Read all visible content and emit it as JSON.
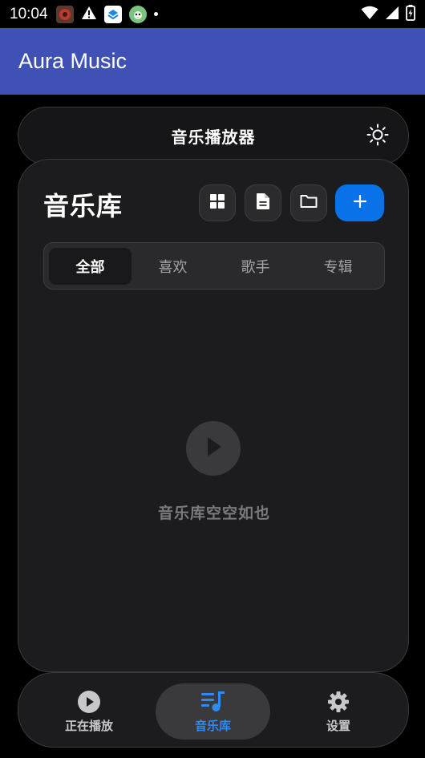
{
  "status_bar": {
    "time": "10:04"
  },
  "app_bar": {
    "title": "Aura Music"
  },
  "header": {
    "title": "音乐播放器",
    "theme_icon": "sun-icon"
  },
  "library": {
    "title": "音乐库",
    "tools": [
      {
        "icon": "grid-icon"
      },
      {
        "icon": "document-icon"
      },
      {
        "icon": "folder-icon"
      }
    ],
    "add_icon": "plus-icon",
    "tabs": [
      {
        "label": "全部",
        "active": true
      },
      {
        "label": "喜欢",
        "active": false
      },
      {
        "label": "歌手",
        "active": false
      },
      {
        "label": "专辑",
        "active": false
      }
    ],
    "empty_state": {
      "icon": "play-icon",
      "text": "音乐库空空如也"
    }
  },
  "bottom_nav": {
    "items": [
      {
        "label": "正在播放",
        "icon": "play-circle-icon",
        "active": false
      },
      {
        "label": "音乐库",
        "icon": "music-queue-icon",
        "active": true
      },
      {
        "label": "设置",
        "icon": "gear-icon",
        "active": false
      }
    ]
  },
  "colors": {
    "app_bar": "#3f51b5",
    "accent": "#0a72e8",
    "active_nav": "#2f8af5",
    "panel": "#1c1c1e"
  }
}
